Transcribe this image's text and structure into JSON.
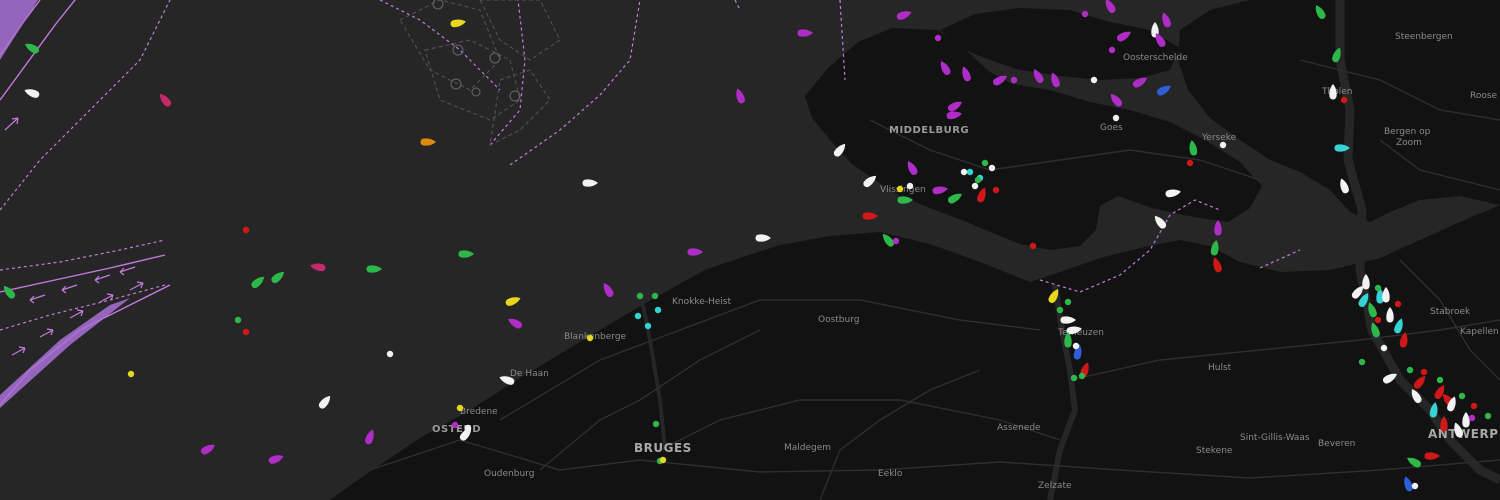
{
  "map": {
    "colors": {
      "sea": "#262626",
      "land": "#121212",
      "roads": "#2e2e2e",
      "shipping_lanes": "#c77ae0",
      "labels": "#8a8a8a"
    },
    "places": [
      {
        "name": "Steenbergen",
        "class": "place"
      },
      {
        "name": "Tholen",
        "class": "place"
      },
      {
        "name": "Roose",
        "class": "place"
      },
      {
        "name": "Oosterschelde",
        "class": "place"
      },
      {
        "name": "MIDDELBURG",
        "class": "place-major"
      },
      {
        "name": "Goes",
        "class": "place"
      },
      {
        "name": "Yerseke",
        "class": "place"
      },
      {
        "name": "Bergen op",
        "class": "place"
      },
      {
        "name": "Zoom",
        "class": "place"
      },
      {
        "name": "Vlissingen",
        "class": "place"
      },
      {
        "name": "Knokke-Heist",
        "class": "place"
      },
      {
        "name": "Oostburg",
        "class": "place"
      },
      {
        "name": "Terneuzen",
        "class": "place"
      },
      {
        "name": "Stabroek",
        "class": "place"
      },
      {
        "name": "Kapellen",
        "class": "place"
      },
      {
        "name": "Blankenberge",
        "class": "place"
      },
      {
        "name": "De Haan",
        "class": "place"
      },
      {
        "name": "Hulst",
        "class": "place"
      },
      {
        "name": "Bredene",
        "class": "place"
      },
      {
        "name": "OSTEND",
        "class": "place-major"
      },
      {
        "name": "BRUGES",
        "class": "place-city"
      },
      {
        "name": "Assenede",
        "class": "place"
      },
      {
        "name": "Sint-Gillis-Waas",
        "class": "place"
      },
      {
        "name": "ANTWERP",
        "class": "place-city"
      },
      {
        "name": "Stekene",
        "class": "place"
      },
      {
        "name": "Beveren",
        "class": "place"
      },
      {
        "name": "Maldegem",
        "class": "place"
      },
      {
        "name": "Oudenburg",
        "class": "place"
      },
      {
        "name": "Eeklo",
        "class": "place"
      },
      {
        "name": "Zelzate",
        "class": "place"
      }
    ],
    "vessel_colors": {
      "passenger": "#2fb84a",
      "cargo": "#b02cc7",
      "tanker": "#d01818",
      "high_speed": "#e6d81e",
      "tug_special": "#36d3d6",
      "fishing": "#e08a10",
      "pleasure": "#c42a6a",
      "navaid": "#2e5fd6",
      "unknown": "#f2f2f2"
    }
  }
}
